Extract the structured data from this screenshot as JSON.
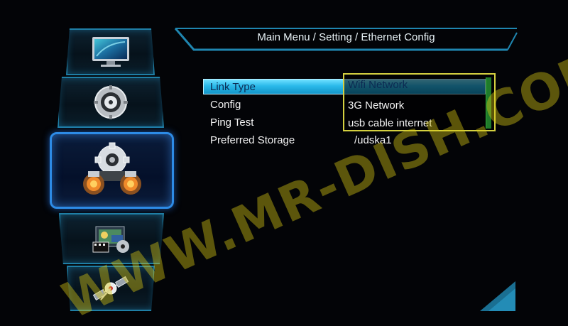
{
  "header": {
    "title": "Main Menu / Setting / Ethernet Config"
  },
  "settings": [
    {
      "label": "Link Type",
      "value": "Wifi Network",
      "selected": true
    },
    {
      "label": "Config",
      "value": ""
    },
    {
      "label": "Ping Test",
      "value": ""
    },
    {
      "label": "Preferred Storage",
      "value": "/udska1"
    }
  ],
  "dropdown": {
    "options": [
      "Wifi Network",
      "3G Network",
      "usb cable internet"
    ],
    "selected": "Wifi Network"
  },
  "sidebar": {
    "items": [
      {
        "id": "tv",
        "icon": "tv-monitor-icon"
      },
      {
        "id": "settings",
        "icon": "settings-disc-icon"
      },
      {
        "id": "system",
        "icon": "system-gears-icon",
        "active": true
      },
      {
        "id": "media",
        "icon": "media-icon"
      },
      {
        "id": "satellite",
        "icon": "satellite-icon"
      }
    ]
  },
  "watermark": "WWW.MR-DISH.COM",
  "colors": {
    "accent": "#1f7fa6",
    "highlight": "#2ab9ea",
    "dropdown_border": "#d4d040",
    "watermark": "#d8c814"
  }
}
